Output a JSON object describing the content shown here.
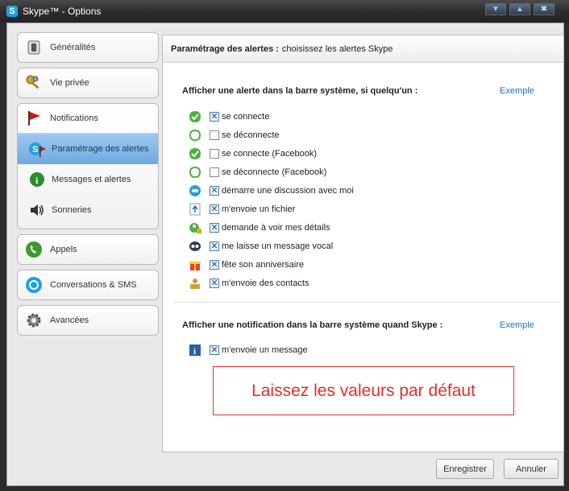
{
  "window": {
    "title": "Skype™ - Options",
    "logo": "S",
    "controls": {
      "minimize": "▼",
      "maximize": "▲",
      "close": "✖"
    }
  },
  "sidebar": {
    "items": [
      {
        "label": "Généralités",
        "icon": "general-icon"
      },
      {
        "label": "Vie privée",
        "icon": "privacy-keys-icon"
      },
      {
        "label": "Notifications",
        "icon": "flag-icon"
      },
      {
        "label": "Appels",
        "icon": "phone-icon"
      },
      {
        "label": "Conversations & SMS",
        "icon": "chat-icon"
      },
      {
        "label": "Avancées",
        "icon": "gear-icon"
      }
    ],
    "notification_subitems": [
      {
        "label": "Paramétrage des alertes",
        "icon": "skype-flag-icon",
        "active": true
      },
      {
        "label": "Messages et alertes",
        "icon": "info-icon",
        "active": false
      },
      {
        "label": "Sonneries",
        "icon": "speaker-icon",
        "active": false
      }
    ]
  },
  "panel": {
    "header_bold": "Paramétrage des alertes :",
    "header_rest": "choisissez les alertes Skype",
    "section1_title": "Afficher une alerte dans la barre système, si quelqu'un :",
    "section2_title": "Afficher une notification dans la barre système quand Skype :",
    "example_link": "Exemple",
    "alerts": [
      {
        "label": "se connecte",
        "checked": true,
        "icon": "online-status-icon"
      },
      {
        "label": "se déconnecte",
        "checked": false,
        "icon": "offline-status-icon"
      },
      {
        "label": "se connecte (Facebook)",
        "checked": false,
        "icon": "online-status-icon"
      },
      {
        "label": "se déconnecte (Facebook)",
        "checked": false,
        "icon": "offline-status-icon"
      },
      {
        "label": "démarre une discussion avec moi",
        "checked": true,
        "icon": "chat-bubble-icon"
      },
      {
        "label": "m'envoie un fichier",
        "checked": true,
        "icon": "file-upload-icon"
      },
      {
        "label": "demande à voir mes détails",
        "checked": true,
        "icon": "contact-request-icon"
      },
      {
        "label": "me laisse un message vocal",
        "checked": true,
        "icon": "voicemail-icon"
      },
      {
        "label": "fête son anniversaire",
        "checked": true,
        "icon": "gift-icon"
      },
      {
        "label": "m'envoie des contacts",
        "checked": true,
        "icon": "contacts-icon"
      }
    ],
    "notifications": [
      {
        "label": "m'envoie un message",
        "checked": true,
        "icon": "info-square-icon"
      }
    ],
    "notice": "Laissez les valeurs par défaut"
  },
  "footer": {
    "save_label": "Enregistrer",
    "cancel_label": "Annuler"
  }
}
